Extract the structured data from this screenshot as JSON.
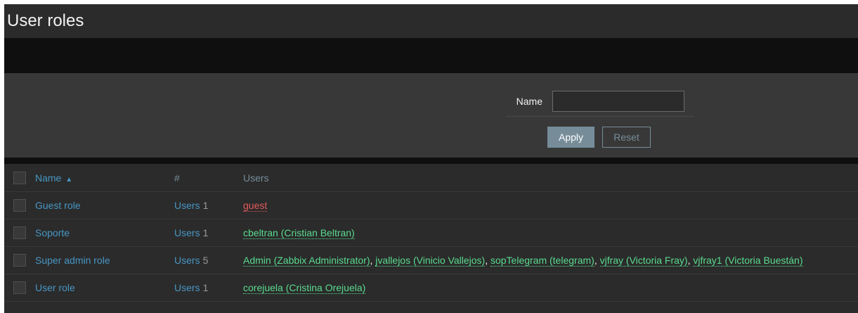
{
  "page": {
    "title": "User roles"
  },
  "filter": {
    "name_label": "Name",
    "name_value": "",
    "apply_label": "Apply",
    "reset_label": "Reset"
  },
  "table": {
    "columns": {
      "name": "Name",
      "sort_indicator": "▲",
      "count": "#",
      "users": "Users"
    },
    "rows": [
      {
        "name": "Guest role",
        "users_link": "Users",
        "count": "1",
        "users": [
          {
            "text": "guest",
            "status": "red"
          }
        ]
      },
      {
        "name": "Soporte",
        "users_link": "Users",
        "count": "1",
        "users": [
          {
            "text": "cbeltran (Cristian Beltran)",
            "status": "green"
          }
        ]
      },
      {
        "name": "Super admin role",
        "users_link": "Users",
        "count": "5",
        "users": [
          {
            "text": "Admin (Zabbix Administrator)",
            "status": "green"
          },
          {
            "text": "jvallejos (Vinicio Vallejos)",
            "status": "green"
          },
          {
            "text": "sopTelegram (telegram)",
            "status": "green"
          },
          {
            "text": "vjfray (Victoria Fray)",
            "status": "green"
          },
          {
            "text": "vjfray1 (Victoria Buestán)",
            "status": "green"
          }
        ]
      },
      {
        "name": "User role",
        "users_link": "Users",
        "count": "1",
        "users": [
          {
            "text": "corejuela (Cristina Orejuela)",
            "status": "green"
          }
        ]
      }
    ]
  },
  "colors": {
    "link": "#4796c4",
    "user_enabled": "#59db8f",
    "user_disabled": "#e45959",
    "button": "#768d99"
  }
}
